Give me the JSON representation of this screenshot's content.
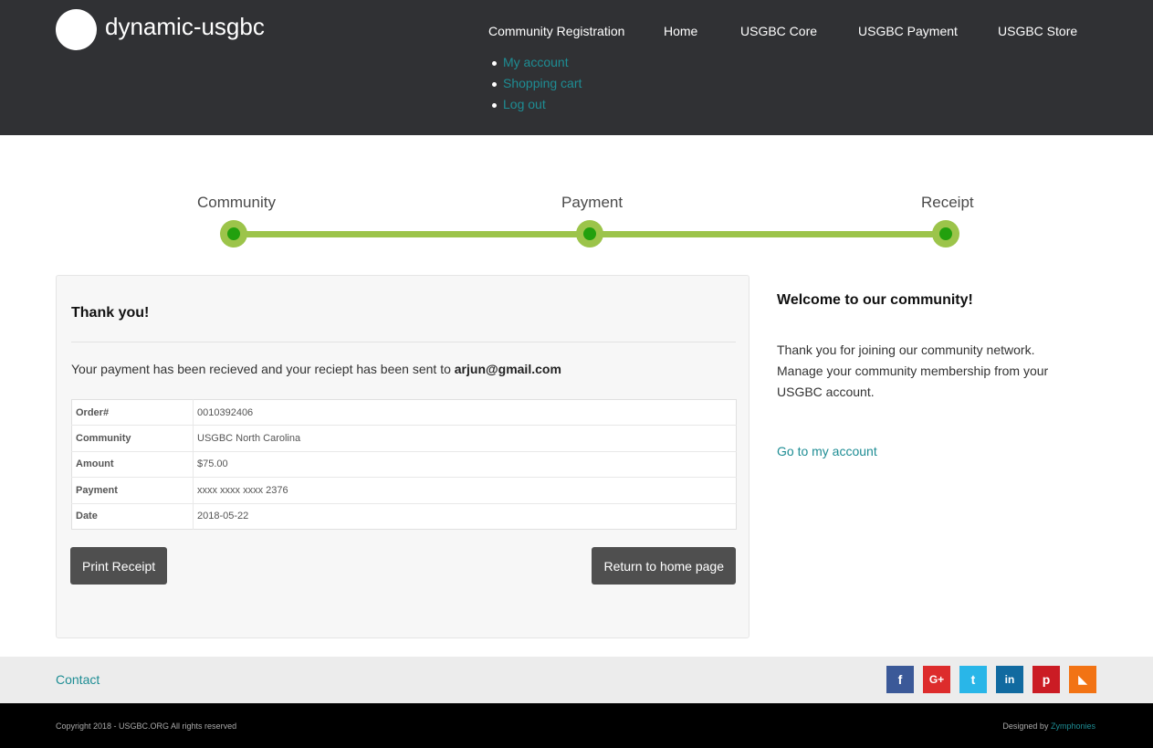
{
  "header": {
    "site_name": "dynamic-usgbc",
    "nav": [
      {
        "label": "Community Registration"
      },
      {
        "label": "Home"
      },
      {
        "label": "USGBC Core"
      },
      {
        "label": "USGBC Payment"
      },
      {
        "label": "USGBC Store"
      }
    ],
    "submenu": [
      {
        "label": "My account"
      },
      {
        "label": "Shopping cart"
      },
      {
        "label": "Log out"
      }
    ]
  },
  "progress": {
    "steps": [
      {
        "label": "Community"
      },
      {
        "label": "Payment"
      },
      {
        "label": "Receipt"
      }
    ]
  },
  "receipt": {
    "title": "Thank you!",
    "message": "Your payment has been recieved and your reciept has been sent to",
    "email": "arjun@gmail.com",
    "rows": [
      {
        "key": "Order#",
        "value": "0010392406"
      },
      {
        "key": "Community",
        "value": "USGBC North Carolina"
      },
      {
        "key": "Amount",
        "value": "$75.00"
      },
      {
        "key": "Payment",
        "value": "xxxx xxxx xxxx 2376"
      },
      {
        "key": "Date",
        "value": "2018-05-22"
      }
    ],
    "print_button": "Print Receipt",
    "home_button": "Return to home page"
  },
  "sidebar": {
    "title": "Welcome to our community!",
    "text": "Thank you for joining our community network. Manage your community membership from your USGBC account.",
    "link": "Go to my account"
  },
  "footer": {
    "contact": "Contact",
    "social": [
      {
        "icon": "facebook-icon",
        "glyph": "f",
        "color": "#3b5998"
      },
      {
        "icon": "google-plus-icon",
        "glyph": "G+",
        "color": "#dd2c2c"
      },
      {
        "icon": "twitter-icon",
        "glyph": "t",
        "color": "#29b6e8"
      },
      {
        "icon": "linkedin-icon",
        "glyph": "in",
        "color": "#116aa0"
      },
      {
        "icon": "pinterest-icon",
        "glyph": "p",
        "color": "#cb1c24"
      },
      {
        "icon": "rss-icon",
        "glyph": "◣",
        "color": "#f27314"
      }
    ],
    "copyright": "Copyright 2018 - USGBC.ORG All rights reserved",
    "designed_by_label": "Designed by",
    "designed_by_name": "Zymphonies"
  },
  "colors": {
    "header_bg": "#303134",
    "link": "#1e8d94",
    "progress_line": "#9cc44a",
    "progress_dot": "#22a00e",
    "button_bg": "#4f4f4f",
    "footer_top_bg": "#ececec",
    "footer_bottom_bg": "#000000"
  }
}
